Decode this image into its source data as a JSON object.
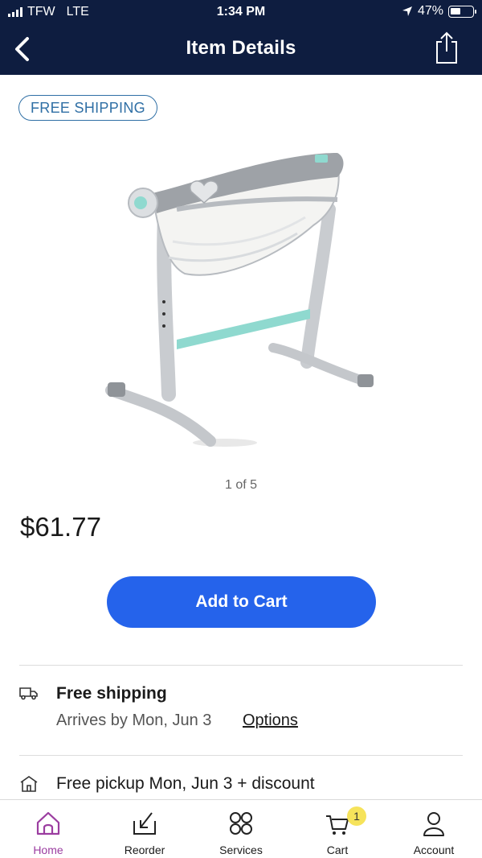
{
  "status_bar": {
    "carrier": "TFW",
    "network": "LTE",
    "time": "1:34 PM",
    "battery_percent": "47%",
    "battery_level": 0.47
  },
  "nav": {
    "title": "Item Details",
    "back_icon": "chevron-left-icon",
    "share_icon": "share-icon"
  },
  "product": {
    "badge": "FREE SHIPPING",
    "image_counter": "1 of 5",
    "price": "$61.77",
    "add_to_cart_label": "Add to Cart"
  },
  "fulfillment": {
    "shipping_title": "Free shipping",
    "shipping_arrival": "Arrives by Mon, Jun 3",
    "shipping_options_link": "Options",
    "pickup_title": "Free pickup Mon, Jun 3 + discount"
  },
  "tabs": [
    {
      "label": "Home",
      "icon": "home-icon",
      "active": true
    },
    {
      "label": "Reorder",
      "icon": "reorder-icon",
      "active": false
    },
    {
      "label": "Services",
      "icon": "services-icon",
      "active": false
    },
    {
      "label": "Cart",
      "icon": "cart-icon",
      "active": false,
      "badge": "1"
    },
    {
      "label": "Account",
      "icon": "account-icon",
      "active": false
    }
  ],
  "colors": {
    "header_bg": "#0e1d40",
    "primary_button": "#2563eb",
    "active_tab": "#9b3da0",
    "badge_border": "#2f6fa5",
    "cart_badge": "#f6e35b"
  }
}
